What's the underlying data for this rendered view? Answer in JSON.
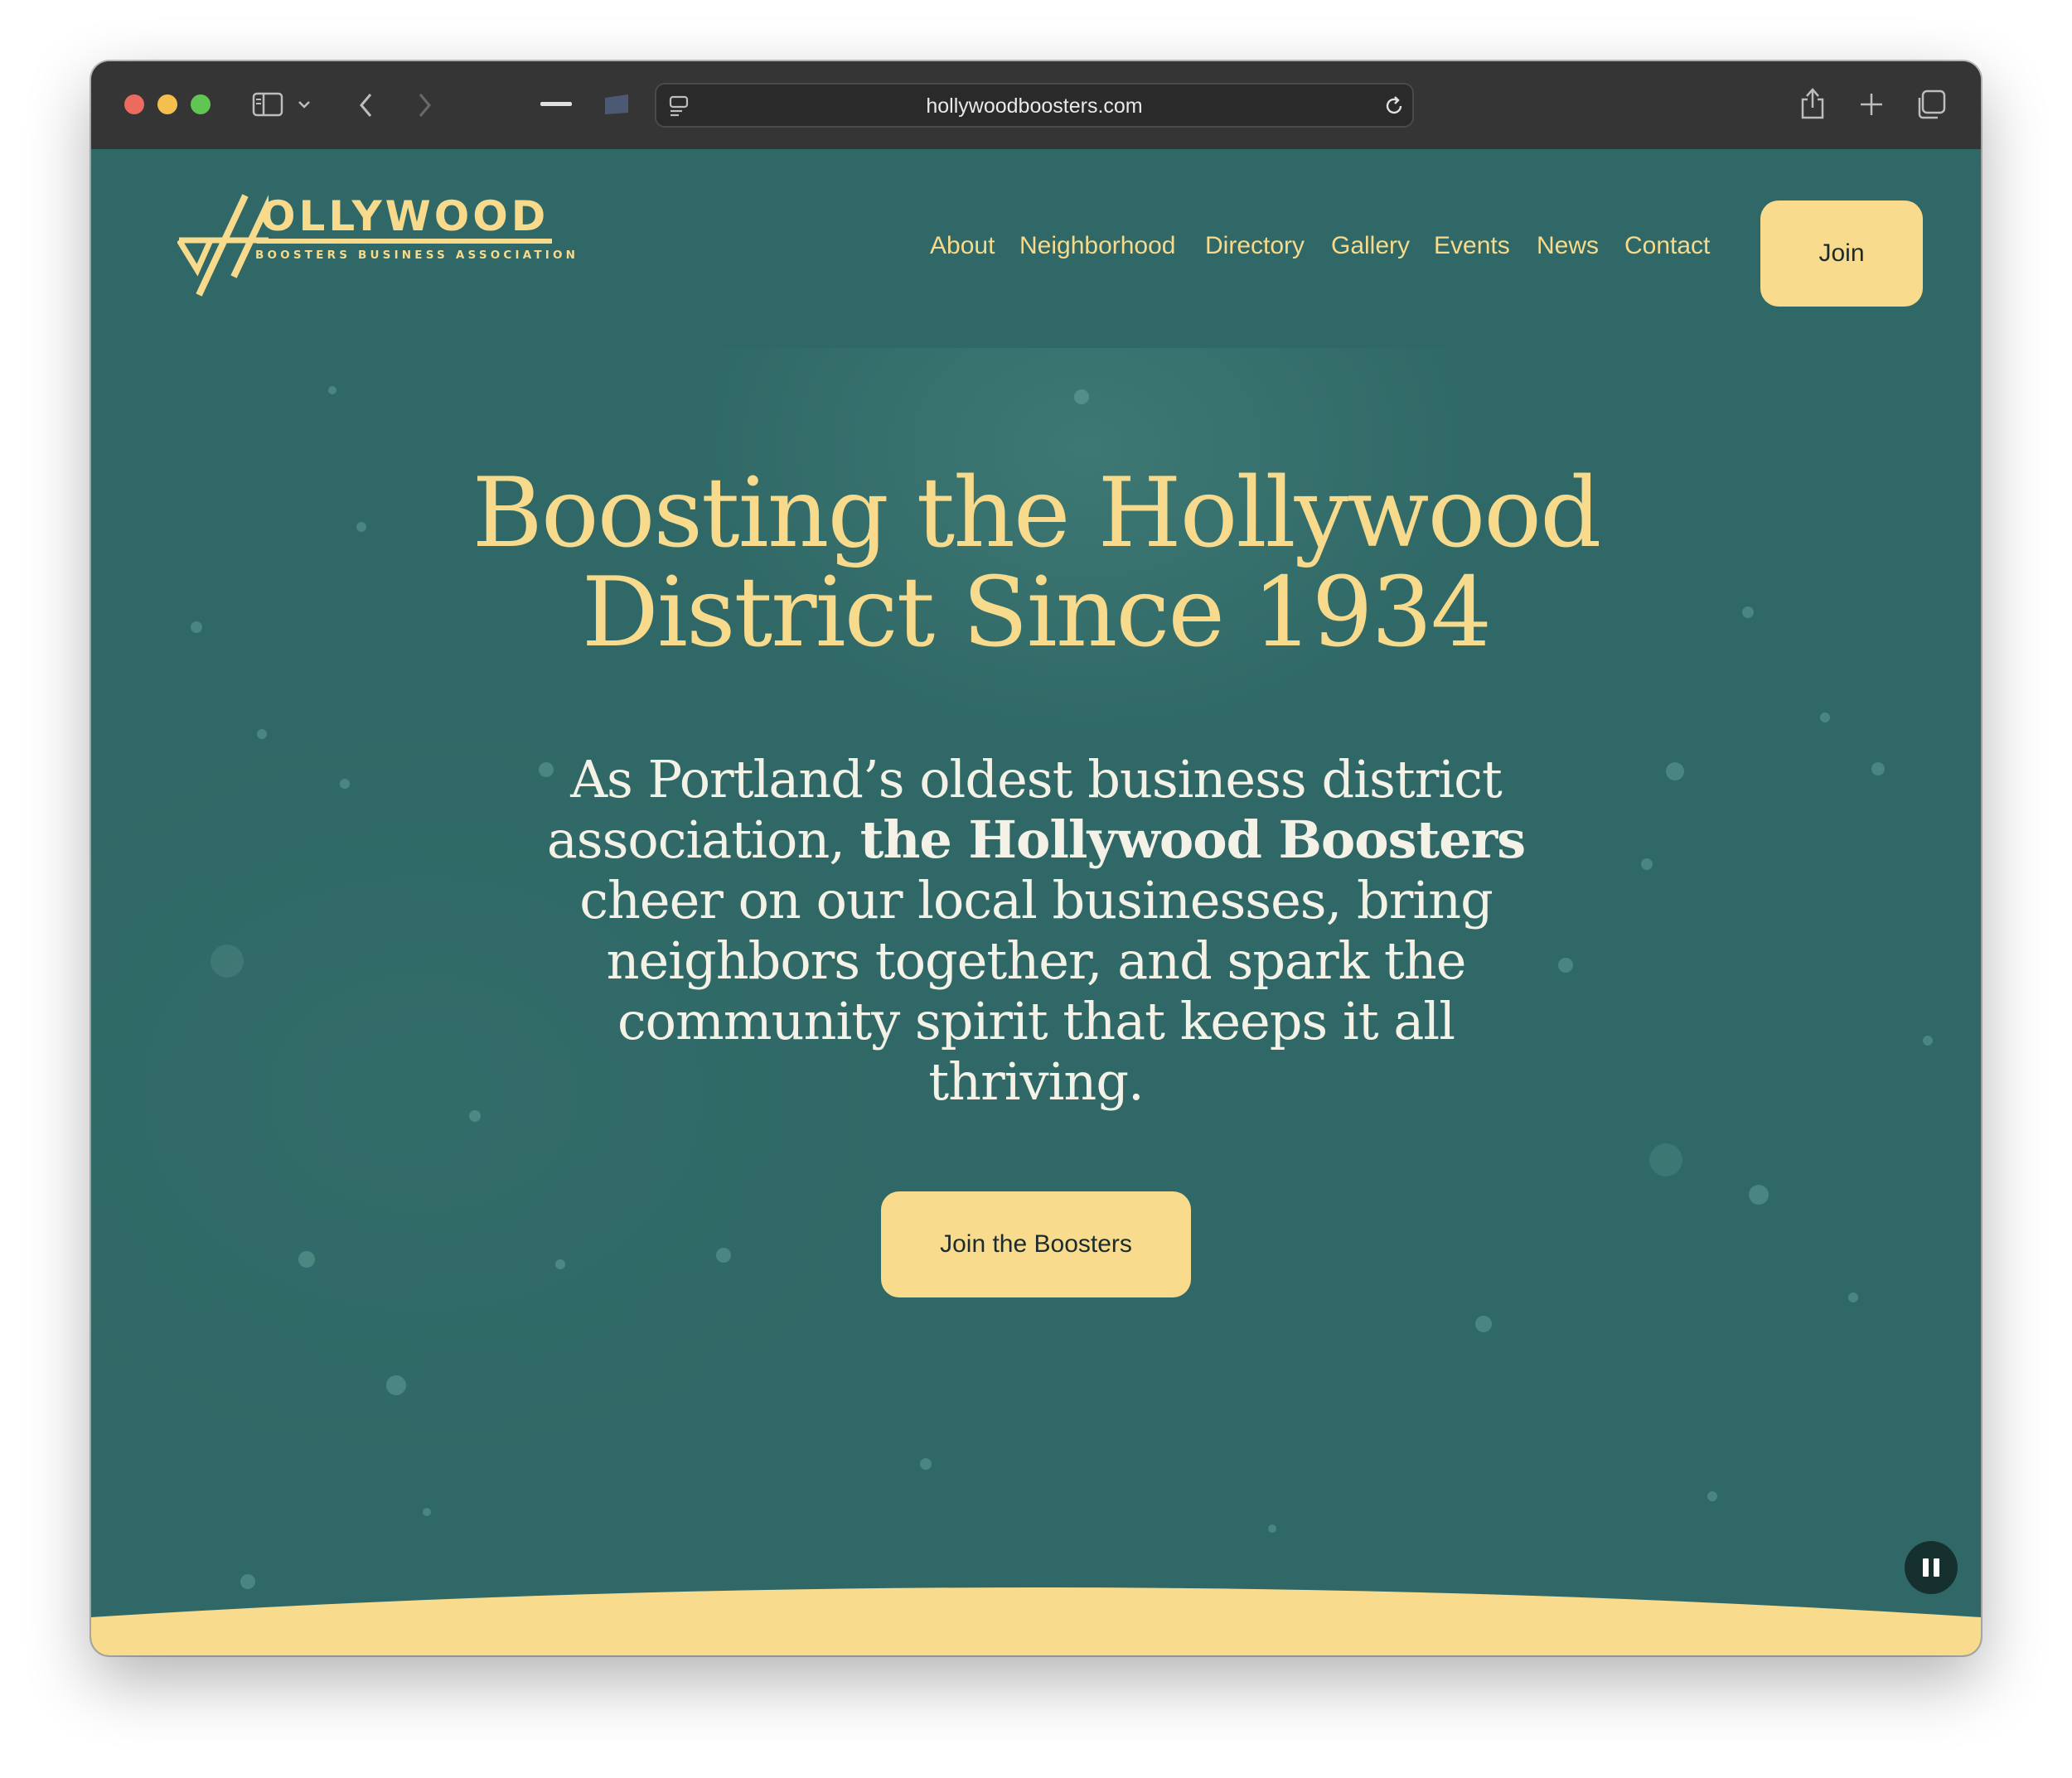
{
  "browser": {
    "url": "hollywoodboosters.com"
  },
  "site": {
    "logo": {
      "wordmark": "OLLYWOOD",
      "subtitle": "BOOSTERS BUSINESS ASSOCIATION"
    },
    "nav": {
      "items": [
        {
          "label": "About"
        },
        {
          "label": "Neighborhood"
        },
        {
          "label": "Directory"
        },
        {
          "label": "Gallery"
        },
        {
          "label": "Events"
        },
        {
          "label": "News"
        },
        {
          "label": "Contact"
        }
      ],
      "join_label": "Join"
    }
  },
  "hero": {
    "headline_line1": "Boosting the Hollywood",
    "headline_line2": "District Since 1934",
    "lead_before": "As Portland’s oldest business district association, ",
    "lead_bold": "the Hollywood Boosters",
    "lead_after": " cheer on our local businesses, bring neighbors together, and spark the community spirit that keeps it all thriving.",
    "cta_label": "Join the Boosters"
  },
  "colors": {
    "background": "#2f6866",
    "accent": "#f8db8c",
    "text_light": "#f4f1e6"
  },
  "icons": {
    "sidebar": "sidebar-icon",
    "back": "chevron-left-icon",
    "forward": "chevron-right-icon",
    "share": "share-icon",
    "new_tab": "plus-icon",
    "tabs": "tab-overview-icon",
    "reload": "reload-icon",
    "pause": "pause-icon"
  }
}
